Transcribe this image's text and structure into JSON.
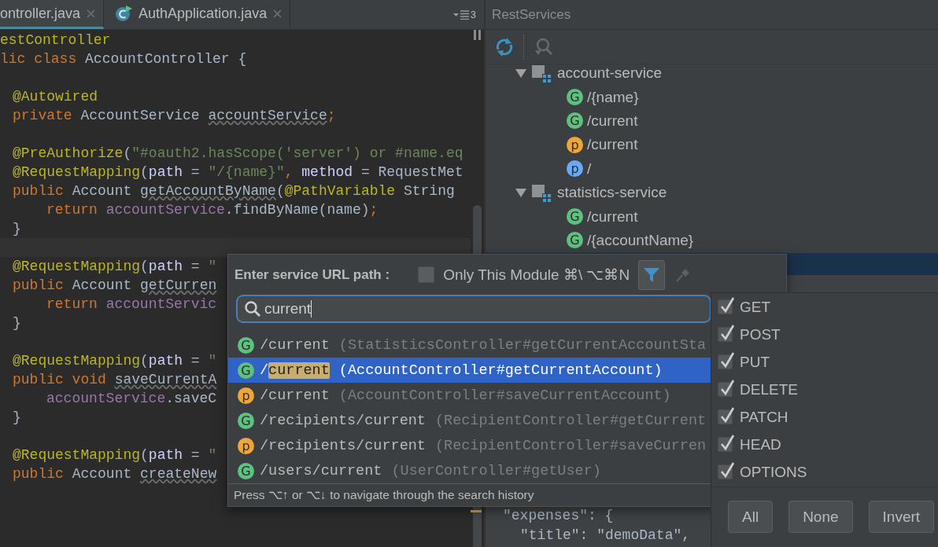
{
  "editor": {
    "tabs": [
      {
        "label": "ontroller.java",
        "kind": "plain",
        "selected": true
      },
      {
        "label": "AuthApplication.java",
        "kind": "class",
        "selected": false
      }
    ],
    "tab_count": "3",
    "lines": [
      {
        "kind": "top",
        "tokens": [
          {
            "kind": "annotation",
            "text": "estController"
          }
        ]
      },
      {
        "kind": "top",
        "tokens": [
          {
            "kind": "keyword",
            "text": "lic class "
          },
          {
            "kind": "plain",
            "text": "AccountController {"
          }
        ]
      },
      {
        "kind": "blank"
      },
      {
        "kind": "member",
        "tokens": [
          {
            "kind": "annotation",
            "text": "@Autowired"
          }
        ]
      },
      {
        "kind": "member",
        "tokens": [
          {
            "kind": "keyword",
            "text": "private "
          },
          {
            "kind": "plain",
            "text": "AccountService "
          },
          {
            "kind": "unused",
            "text": "accountService"
          },
          {
            "kind": "keyword",
            "text": ";"
          }
        ]
      },
      {
        "kind": "blank"
      },
      {
        "kind": "member",
        "tokens": [
          {
            "kind": "annotation",
            "text": "@PreAuthorize"
          },
          {
            "kind": "plain",
            "text": "("
          },
          {
            "kind": "string",
            "text": "\"#oauth2.hasScope('server') or #name.eq"
          }
        ]
      },
      {
        "kind": "member",
        "tokens": [
          {
            "kind": "annotation",
            "text": "@RequestMapping"
          },
          {
            "kind": "plain",
            "text": "("
          },
          {
            "kind": "attr",
            "text": "path"
          },
          {
            "kind": "plain",
            "text": " = "
          },
          {
            "kind": "string",
            "text": "\"/{name}\""
          },
          {
            "kind": "keyword",
            "text": ", "
          },
          {
            "kind": "attr",
            "text": "method"
          },
          {
            "kind": "plain",
            "text": " = RequestMet"
          }
        ]
      },
      {
        "kind": "member",
        "tokens": [
          {
            "kind": "keyword",
            "text": "public "
          },
          {
            "kind": "plain",
            "text": "Account "
          },
          {
            "kind": "unused",
            "text": "getAccountByName"
          },
          {
            "kind": "plain",
            "text": "("
          },
          {
            "kind": "annotation",
            "text": "@PathVariable"
          },
          {
            "kind": "plain",
            "text": " String"
          }
        ]
      },
      {
        "kind": "body",
        "tokens": [
          {
            "kind": "keyword",
            "text": "return "
          },
          {
            "kind": "field",
            "text": "accountService"
          },
          {
            "kind": "plain",
            "text": ".findByName(name)"
          },
          {
            "kind": "keyword",
            "text": ";"
          }
        ]
      },
      {
        "kind": "member",
        "tokens": [
          {
            "kind": "plain",
            "text": "}"
          }
        ]
      },
      {
        "kind": "caret"
      },
      {
        "kind": "member",
        "tokens": [
          {
            "kind": "annotation",
            "text": "@RequestMapping"
          },
          {
            "kind": "plain",
            "text": "("
          },
          {
            "kind": "attr",
            "text": "path"
          },
          {
            "kind": "plain",
            "text": " = "
          },
          {
            "kind": "string",
            "text": "\""
          }
        ]
      },
      {
        "kind": "member",
        "tokens": [
          {
            "kind": "keyword",
            "text": "public "
          },
          {
            "kind": "plain",
            "text": "Account "
          },
          {
            "kind": "unused",
            "text": "getCurren"
          }
        ]
      },
      {
        "kind": "body",
        "tokens": [
          {
            "kind": "keyword",
            "text": "return "
          },
          {
            "kind": "field",
            "text": "accountServic"
          }
        ]
      },
      {
        "kind": "member",
        "tokens": [
          {
            "kind": "plain",
            "text": "}"
          }
        ]
      },
      {
        "kind": "blank"
      },
      {
        "kind": "member",
        "tokens": [
          {
            "kind": "annotation",
            "text": "@RequestMapping"
          },
          {
            "kind": "plain",
            "text": "("
          },
          {
            "kind": "attr",
            "text": "path"
          },
          {
            "kind": "plain",
            "text": " = "
          },
          {
            "kind": "string",
            "text": "\""
          }
        ]
      },
      {
        "kind": "member",
        "tokens": [
          {
            "kind": "keyword",
            "text": "public void "
          },
          {
            "kind": "unused",
            "text": "saveCurrentA"
          }
        ]
      },
      {
        "kind": "body",
        "tokens": [
          {
            "kind": "field",
            "text": "accountService"
          },
          {
            "kind": "plain",
            "text": ".saveC"
          }
        ]
      },
      {
        "kind": "member",
        "tokens": [
          {
            "kind": "plain",
            "text": "}"
          }
        ]
      },
      {
        "kind": "blank"
      },
      {
        "kind": "member",
        "tokens": [
          {
            "kind": "annotation",
            "text": "@RequestMapping"
          },
          {
            "kind": "plain",
            "text": "("
          },
          {
            "kind": "attr",
            "text": "path"
          },
          {
            "kind": "plain",
            "text": " = "
          },
          {
            "kind": "string",
            "text": "\""
          }
        ]
      },
      {
        "kind": "member",
        "tokens": [
          {
            "kind": "keyword",
            "text": "public "
          },
          {
            "kind": "plain",
            "text": "Account "
          },
          {
            "kind": "unused",
            "text": "createNew"
          }
        ]
      }
    ]
  },
  "rest_panel": {
    "title": "RestServices",
    "toolbar": [
      {
        "kind": "refresh",
        "disabled": false
      },
      {
        "kind": "locate",
        "disabled": true
      }
    ],
    "tree": [
      {
        "label": "account-service",
        "expanded": true,
        "children": [
          {
            "badge": "G",
            "color": "#5cc27e",
            "label": "/{name}"
          },
          {
            "badge": "G",
            "color": "#5cc27e",
            "label": "/current"
          },
          {
            "badge": "p",
            "color": "#eea53a",
            "label": "/current"
          },
          {
            "badge": "p",
            "color": "#6aaaf5",
            "label": "/"
          }
        ]
      },
      {
        "label": "statistics-service",
        "expanded": true,
        "children": [
          {
            "badge": "G",
            "color": "#5cc27e",
            "label": "/current"
          },
          {
            "badge": "G",
            "color": "#5cc27e",
            "label": "/{accountName}"
          }
        ]
      }
    ],
    "json_preview": [
      {
        "text": "\"expenses\": {",
        "children": [
          {
            "text": "\"title\": \"demoData\","
          }
        ]
      }
    ]
  },
  "popup": {
    "title": "Enter service URL path :",
    "only_module": {
      "label": "Only This Module ⌘\\ ⌥⌘N",
      "checked": false
    },
    "filter_button": {
      "selected": true
    },
    "search": {
      "value": "current"
    },
    "results": [
      {
        "badge": "G",
        "color": "#5cc27e",
        "path": [
          {
            "text": "/current",
            "highlighted": false
          }
        ],
        "detail": "(StatisticsController#getCurrentAccountSta",
        "selected": false
      },
      {
        "badge": "G",
        "color": "#5cc27e",
        "path": [
          {
            "text": "/",
            "highlighted": false
          },
          {
            "text": "current",
            "highlighted": true
          }
        ],
        "detail": "(AccountController#getCurrentAccount)",
        "selected": true
      },
      {
        "badge": "p",
        "color": "#eea53a",
        "path": [
          {
            "text": "/current",
            "highlighted": false
          }
        ],
        "detail": "(AccountController#saveCurrentAccount)",
        "selected": false
      },
      {
        "badge": "G",
        "color": "#5cc27e",
        "path": [
          {
            "text": "/recipients/current",
            "highlighted": false
          }
        ],
        "detail": "(RecipientController#getCurrent",
        "selected": false
      },
      {
        "badge": "p",
        "color": "#eea53a",
        "path": [
          {
            "text": "/recipients/current",
            "highlighted": false
          }
        ],
        "detail": "(RecipientController#saveCurren",
        "selected": false
      },
      {
        "badge": "G",
        "color": "#5cc27e",
        "path": [
          {
            "text": "/users/current",
            "highlighted": false
          }
        ],
        "detail": "(UserController#getUser)",
        "selected": false
      }
    ],
    "hint": "Press ⌥↑ or ⌥↓ to navigate through the search history"
  },
  "method_filter": {
    "methods": [
      {
        "label": "GET",
        "checked": true
      },
      {
        "label": "POST",
        "checked": true
      },
      {
        "label": "PUT",
        "checked": true
      },
      {
        "label": "DELETE",
        "checked": true
      },
      {
        "label": "PATCH",
        "checked": true
      },
      {
        "label": "HEAD",
        "checked": true
      },
      {
        "label": "OPTIONS",
        "checked": true
      }
    ],
    "buttons": [
      "All",
      "None",
      "Invert"
    ]
  }
}
